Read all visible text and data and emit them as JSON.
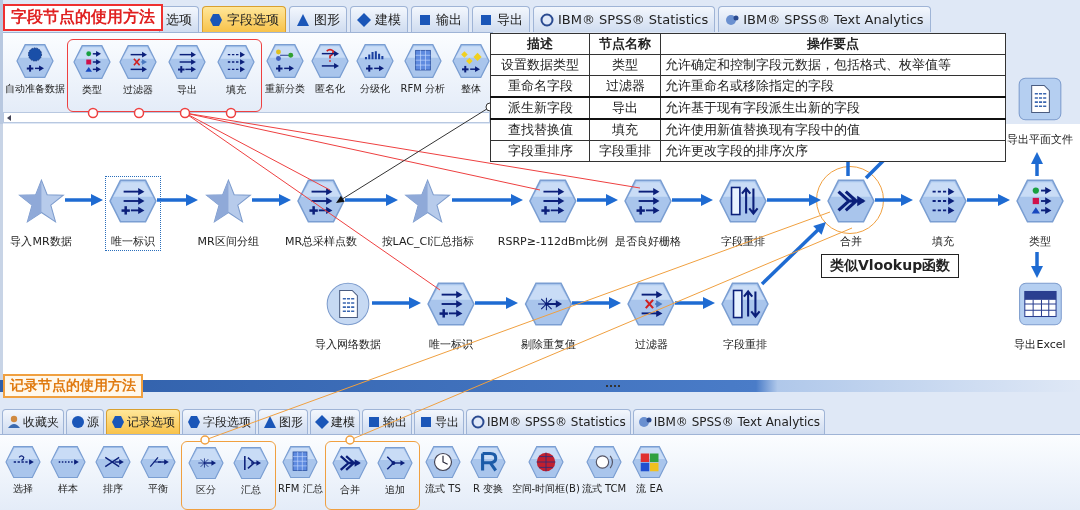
{
  "field_section": {
    "title": "字段节点的使用方法",
    "tabs": [
      {
        "label": "选项",
        "selected": false
      },
      {
        "label": "字段选项",
        "kind": "fields",
        "selected": true
      },
      {
        "label": "图形",
        "kind": "graphs",
        "selected": false
      },
      {
        "label": "建模",
        "kind": "modeling",
        "selected": false
      },
      {
        "label": "输出",
        "kind": "output",
        "selected": false
      },
      {
        "label": "导出",
        "kind": "export",
        "selected": false
      },
      {
        "label": "IBM® SPSS® Statistics",
        "kind": "statistics",
        "selected": false
      },
      {
        "label": "IBM® SPSS® Text Analytics",
        "kind": "text_analytics",
        "selected": false
      }
    ],
    "palette": [
      {
        "label": "自动准备数据",
        "kind": "auto",
        "highlighted": false
      },
      {
        "label": "类型",
        "kind": "type",
        "highlighted": true
      },
      {
        "label": "过滤器",
        "kind": "filter",
        "highlighted": true
      },
      {
        "label": "导出",
        "kind": "derive",
        "highlighted": true
      },
      {
        "label": "填充",
        "kind": "filler",
        "highlighted": true
      },
      {
        "label": "重新分类",
        "kind": "reclassify",
        "highlighted": false
      },
      {
        "label": "匿名化",
        "kind": "anonymize",
        "highlighted": false
      },
      {
        "label": "分级化",
        "kind": "binning",
        "highlighted": false
      },
      {
        "label": "RFM 分析",
        "kind": "rfm",
        "highlighted": false
      },
      {
        "label": "整体",
        "kind": "ensemble",
        "highlighted": false
      }
    ]
  },
  "node_table": {
    "columns": [
      "描述",
      "节点名称",
      "操作要点"
    ],
    "rows": [
      [
        "设置数据类型",
        "类型",
        "允许确定和控制字段元数据，包括格式、枚举值等"
      ],
      [
        "重命名字段",
        "过滤器",
        "允许重命名或移除指定的字段"
      ],
      [
        "派生新字段",
        "导出",
        "允许基于现有字段派生出新的字段"
      ],
      [
        "查找替换值",
        "填充",
        "允许使用新值替换现有字段中的值"
      ],
      [
        "字段重排序",
        "字段重排",
        "允许更改字段的排序次序"
      ]
    ]
  },
  "stream": {
    "nodes": [
      {
        "label": "导出平面文件",
        "kind": "flatfile",
        "selected": false
      },
      {
        "label": "导入MR数据",
        "kind": "star",
        "selected": false
      },
      {
        "label": "唯一标识",
        "kind": "derive",
        "selected": true
      },
      {
        "label": "MR区间分组",
        "kind": "star",
        "selected": false
      },
      {
        "label": "MR总采样点数",
        "kind": "derive",
        "selected": false
      },
      {
        "label": "按LAC_CI汇总指标",
        "kind": "star",
        "selected": false
      },
      {
        "label": "RSRP≥-112dBm比例",
        "kind": "derive",
        "selected": false
      },
      {
        "label": "是否良好栅格",
        "kind": "derive",
        "selected": false
      },
      {
        "label": "字段重排",
        "kind": "reorder",
        "selected": false
      },
      {
        "label": "合并",
        "kind": "merge",
        "selected": false
      },
      {
        "label": "填充",
        "kind": "filler",
        "selected": false
      },
      {
        "label": "类型",
        "kind": "type",
        "selected": false
      },
      {
        "label": "导入网络数据",
        "kind": "file",
        "selected": false
      },
      {
        "label": "唯一标识",
        "kind": "derive",
        "selected": false
      },
      {
        "label": "剔除重复值",
        "kind": "distinct",
        "selected": false
      },
      {
        "label": "过滤器",
        "kind": "filter",
        "selected": false
      },
      {
        "label": "字段重排",
        "kind": "reorder",
        "selected": false
      },
      {
        "label": "导出Excel",
        "kind": "excel",
        "selected": false
      }
    ],
    "callout": "类似Vlookup函数"
  },
  "record_section": {
    "title": "记录节点的使用方法",
    "tabs": [
      {
        "label": "收藏夹",
        "kind": "favorites",
        "selected": false
      },
      {
        "label": "源",
        "kind": "sources",
        "selected": false
      },
      {
        "label": "记录选项",
        "kind": "records",
        "selected": true
      },
      {
        "label": "字段选项",
        "kind": "fields",
        "selected": false
      },
      {
        "label": "图形",
        "kind": "graphs",
        "selected": false
      },
      {
        "label": "建模",
        "kind": "modeling",
        "selected": false
      },
      {
        "label": "输出",
        "kind": "output",
        "selected": false
      },
      {
        "label": "导出",
        "kind": "export",
        "selected": false
      },
      {
        "label": "IBM® SPSS® Statistics",
        "kind": "statistics",
        "selected": false
      },
      {
        "label": "IBM® SPSS® Text Analytics",
        "kind": "text_analytics",
        "selected": false
      }
    ],
    "palette": [
      {
        "label": "选择",
        "kind": "select",
        "highlighted": false
      },
      {
        "label": "样本",
        "kind": "sample",
        "highlighted": false
      },
      {
        "label": "排序",
        "kind": "sort",
        "highlighted": false
      },
      {
        "label": "平衡",
        "kind": "balance",
        "highlighted": false
      },
      {
        "label": "区分",
        "kind": "distinct",
        "highlighted": true
      },
      {
        "label": "汇总",
        "kind": "aggregate",
        "highlighted": true
      },
      {
        "label": "RFM 汇总",
        "kind": "rfm",
        "highlighted": false
      },
      {
        "label": "合并",
        "kind": "merge",
        "highlighted": true
      },
      {
        "label": "追加",
        "kind": "append",
        "highlighted": true
      },
      {
        "label": "流式 TS",
        "kind": "ts",
        "highlighted": false
      },
      {
        "label": "R 变换",
        "kind": "r",
        "highlighted": false
      },
      {
        "label": "空间-时间框(B)",
        "kind": "spacetime",
        "highlighted": false
      },
      {
        "label": "流式 TCM",
        "kind": "tcm",
        "highlighted": false
      },
      {
        "label": "流 EA",
        "kind": "ea",
        "highlighted": false
      }
    ]
  }
}
